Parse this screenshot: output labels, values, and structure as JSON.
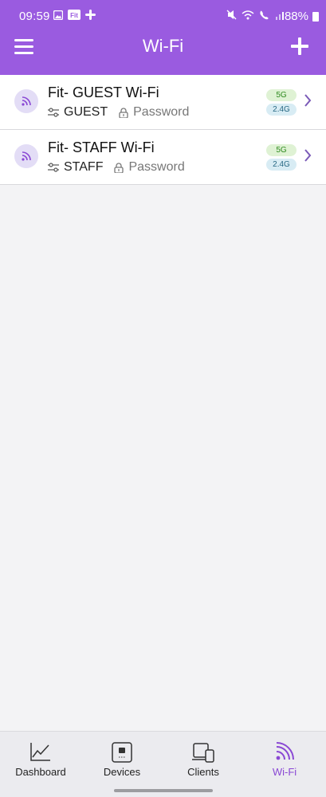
{
  "status_bar": {
    "time": "09:59",
    "battery": "88%",
    "left_icons": [
      "image-icon",
      "fit-app-icon",
      "slack-icon"
    ],
    "right_icons": [
      "mute-icon",
      "wifi-calling-icon",
      "volte-icon",
      "signal-icon",
      "battery-icon"
    ]
  },
  "app_bar": {
    "title": "Wi-Fi",
    "menu_icon": "hamburger-menu-icon",
    "add_icon": "plus-icon"
  },
  "networks": [
    {
      "name": "Fit- GUEST Wi-Fi",
      "profile": "GUEST",
      "security": "Password",
      "bands": [
        "5G",
        "2.4G"
      ]
    },
    {
      "name": "Fit- STAFF Wi-Fi",
      "profile": "STAFF",
      "security": "Password",
      "bands": [
        "5G",
        "2.4G"
      ]
    }
  ],
  "bottom_nav": {
    "tabs": [
      {
        "label": "Dashboard",
        "icon": "line-chart-icon"
      },
      {
        "label": "Devices",
        "icon": "device-icon"
      },
      {
        "label": "Clients",
        "icon": "clients-devices-icon"
      },
      {
        "label": "Wi-Fi",
        "icon": "wifi-icon"
      }
    ],
    "active": "Wi-Fi"
  },
  "colors": {
    "brand": "#9a5be0",
    "active_tab": "#8a48d4",
    "badge_5g_bg": "#dff2d4",
    "badge_24g_bg": "#d8ecf4"
  }
}
